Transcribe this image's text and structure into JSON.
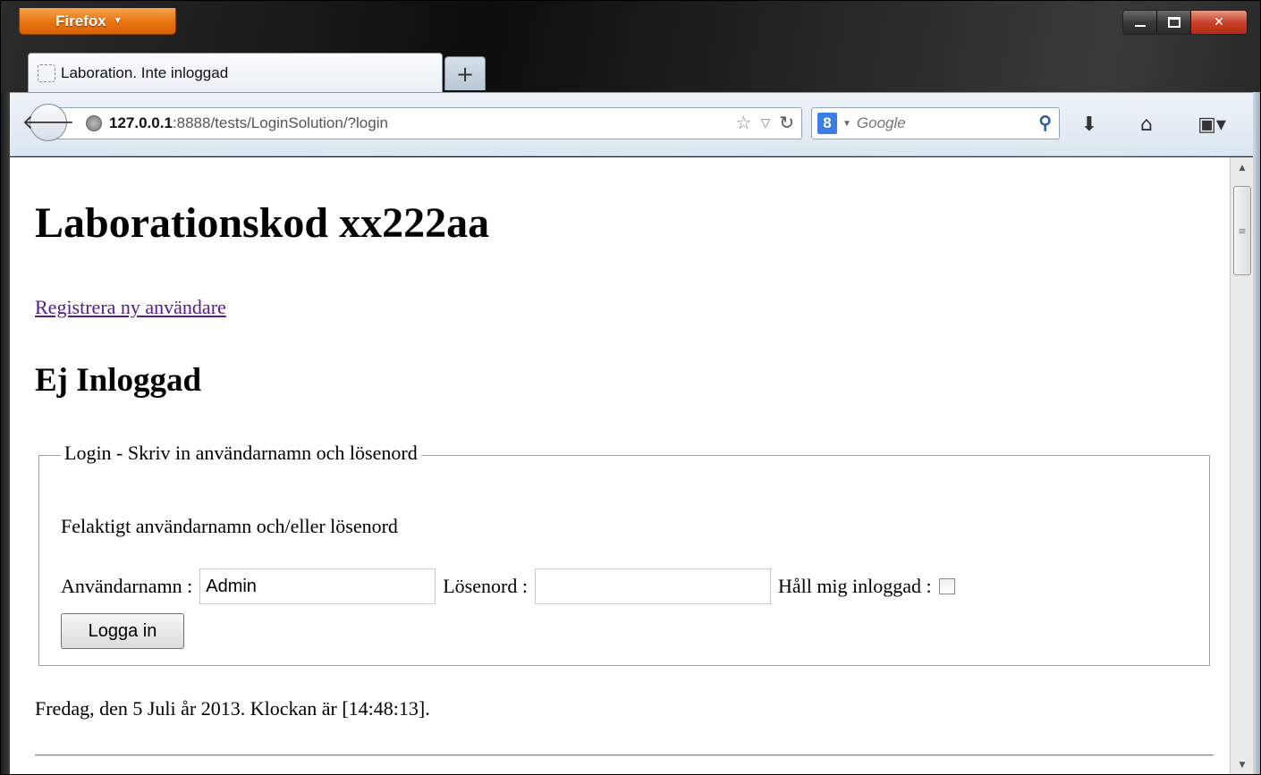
{
  "browser": {
    "app_button": "Firefox",
    "tab_title": "Laboration. Inte inloggad",
    "new_tab": "+",
    "url_host": "127.0.0.1",
    "url_rest": ":8888/tests/LoginSolution/?login",
    "search_engine": "8",
    "search_placeholder": "Google"
  },
  "page": {
    "heading": "Laborationskod xx222aa",
    "register_link": "Registrera ny användare",
    "status_heading": "Ej Inloggad",
    "fieldset_legend": "Login - Skriv in användarnamn och lösenord",
    "error_message": "Felaktigt användarnamn och/eller lösenord",
    "username_label": "Användarnamn :",
    "username_value": "Admin",
    "password_label": "Lösenord :",
    "password_value": "",
    "remember_label": "Håll mig inloggad :",
    "remember_checked": false,
    "submit_label": "Logga in",
    "datetime_text": "Fredag, den 5 Juli år 2013. Klockan är [14:48:13]."
  },
  "colors": {
    "firefox_orange": "#e8730f",
    "close_red": "#c9422a",
    "visited_link": "#551a8b",
    "toolbar_bg": "#dde6f0"
  },
  "icons": [
    "back-icon",
    "globe-icon",
    "star-icon",
    "dropdown-icon",
    "reload-icon",
    "search-icon",
    "download-icon",
    "home-icon",
    "bookmarks-icon"
  ]
}
